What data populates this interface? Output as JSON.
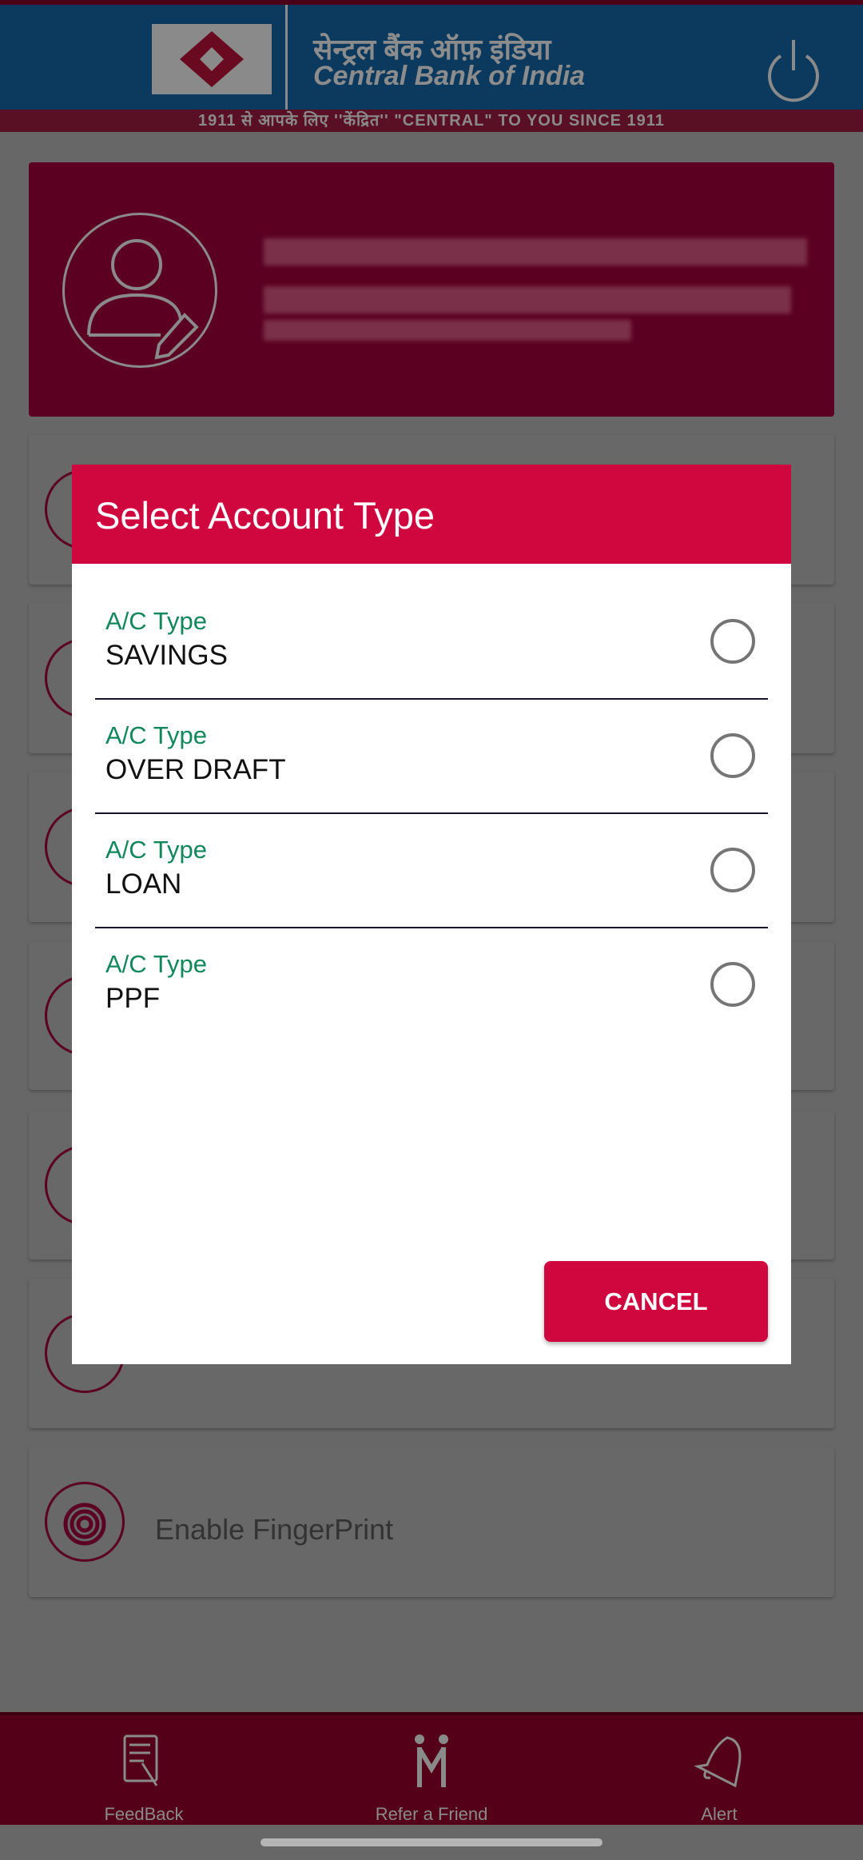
{
  "header": {
    "hindi_name": "सेन्ट्रल बैंक ऑफ़ इंडिया",
    "bank_name": "Central Bank of India",
    "tagline": "1911 से आपके लिए ''केंद्रित''    \"CENTRAL\" TO YOU SINCE 1911",
    "logout_icon": "power-icon"
  },
  "menu": {
    "fingerprint_label": "Enable FingerPrint"
  },
  "dialog": {
    "title": "Select Account Type",
    "options": [
      {
        "label": "A/C Type",
        "value": "SAVINGS",
        "selected": false
      },
      {
        "label": "A/C Type",
        "value": "OVER DRAFT",
        "selected": false
      },
      {
        "label": "A/C Type",
        "value": "LOAN",
        "selected": false
      },
      {
        "label": "A/C Type",
        "value": "PPF",
        "selected": false
      }
    ],
    "cancel_label": "CANCEL"
  },
  "bottom_nav": [
    {
      "label": "FeedBack",
      "icon": "feedback-icon"
    },
    {
      "label": "Refer a Friend",
      "icon": "refer-friend-icon"
    },
    {
      "label": "Alert",
      "icon": "bell-icon"
    }
  ],
  "colors": {
    "accent": "#d0063f",
    "label_green": "#11875a",
    "header_blue": "#0b3a5e"
  }
}
